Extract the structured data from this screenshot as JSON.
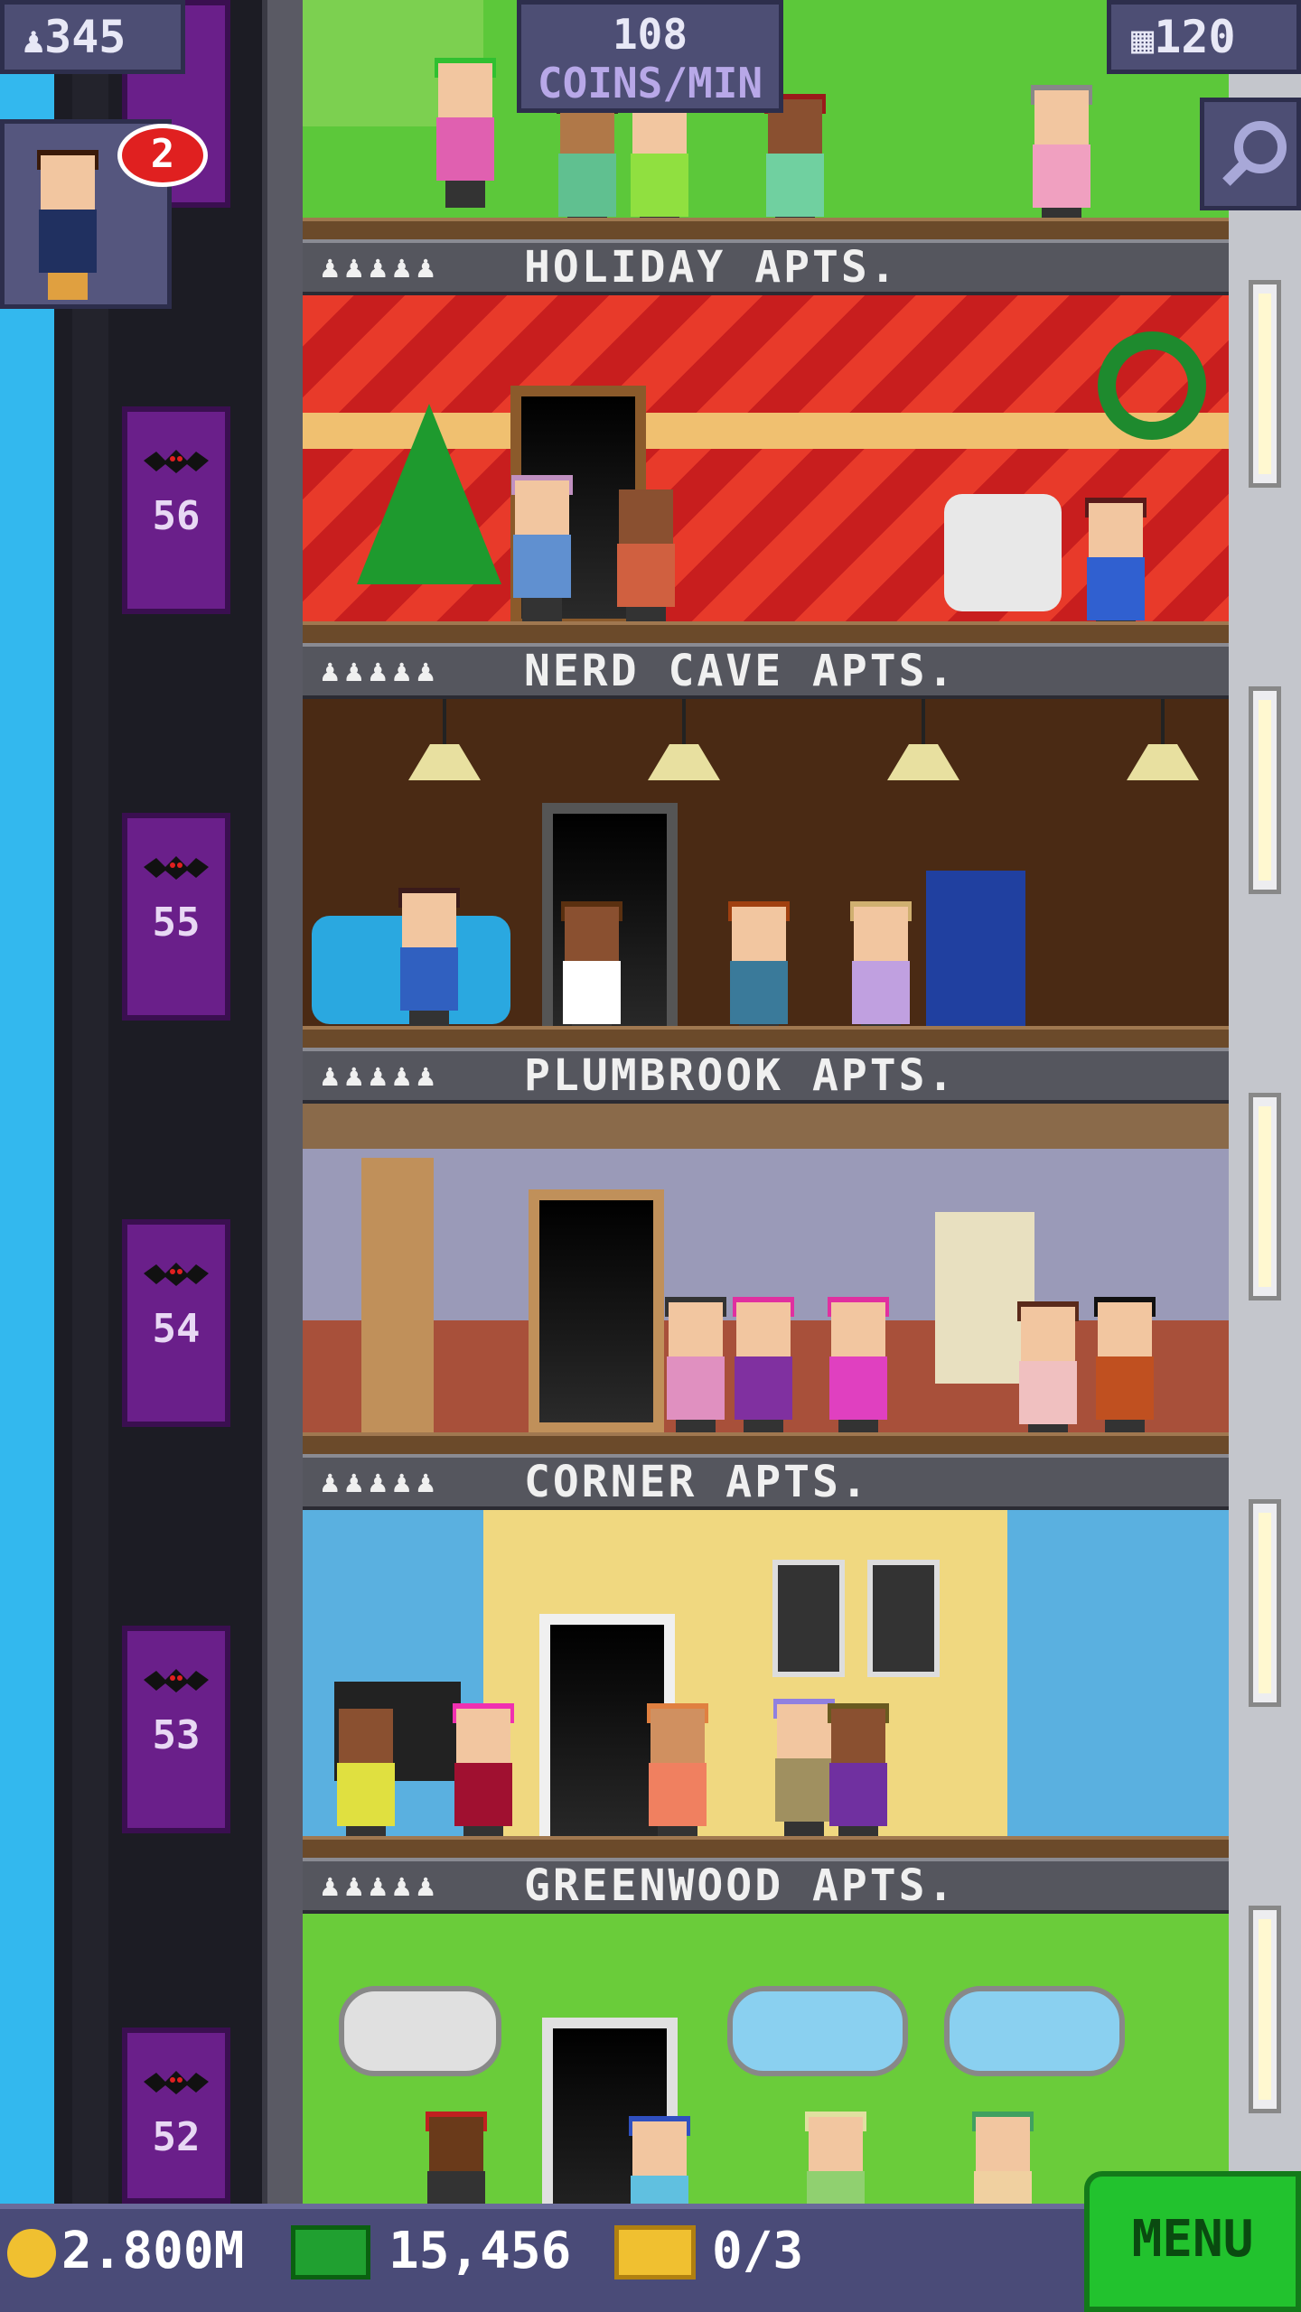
{
  "hud": {
    "population": "345",
    "coins_rate_value": "108",
    "coins_rate_unit": "COINS/MIN",
    "floors": "120",
    "notification_badge": "2"
  },
  "floors": [
    {
      "label": "HOLIDAY APTS.",
      "elevator_number": "",
      "people_icons": "♟♟♟♟♟"
    },
    {
      "label": "NERD CAVE APTS.",
      "elevator_number": "56",
      "people_icons": "♟♟♟♟♟"
    },
    {
      "label": "PLUMBROOK APTS.",
      "elevator_number": "55",
      "people_icons": "♟♟♟♟♟"
    },
    {
      "label": "CORNER APTS.",
      "elevator_number": "54",
      "people_icons": "♟♟♟♟♟"
    },
    {
      "label": "GREENWOOD APTS.",
      "elevator_number": "53",
      "people_icons": "♟♟♟♟♟"
    }
  ],
  "elevators": [
    "56",
    "55",
    "54",
    "53",
    "52"
  ],
  "bottom": {
    "coins": "2.800M",
    "bux": "15,456",
    "tickets": "0/3",
    "menu_label": "MENU"
  },
  "icons": {
    "population": "person-icon",
    "floors": "building-icon",
    "zoom": "magnifier-icon",
    "coins": "coin-icon",
    "bux": "bux-icon",
    "tickets": "ticket-icon"
  },
  "colors": {
    "elevator": "#6a1f8a",
    "hud": "#4d4e74",
    "menu": "#22c22e"
  }
}
